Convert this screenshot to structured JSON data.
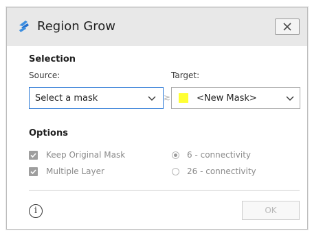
{
  "window": {
    "title": "Region Grow",
    "close_icon": "close-icon",
    "app_icon": "region-grow-icon"
  },
  "selection": {
    "heading": "Selection",
    "source_label": "Source:",
    "source_value": "Select a mask",
    "target_label": "Target:",
    "target_value": "<New Mask>",
    "target_color": "#ffff33",
    "arrow": "≳"
  },
  "options": {
    "heading": "Options",
    "keep_original_mask": {
      "label": "Keep Original Mask",
      "checked": true,
      "enabled": false
    },
    "multiple_layer": {
      "label": "Multiple Layer",
      "checked": true,
      "enabled": false
    },
    "connectivity_6": {
      "label": "6 - connectivity",
      "selected": true
    },
    "connectivity_26": {
      "label": "26 - connectivity",
      "selected": false
    }
  },
  "footer": {
    "info_symbol": "i",
    "ok_label": "OK",
    "ok_enabled": false
  },
  "colors": {
    "accent": "#2b79d6",
    "titlebar": "#e8e8e8"
  }
}
